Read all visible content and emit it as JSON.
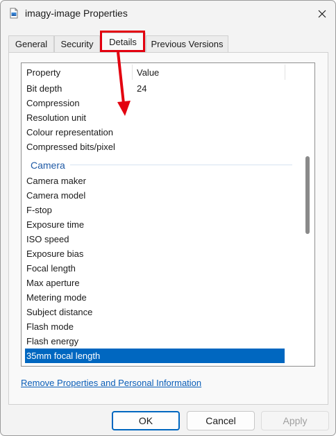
{
  "window": {
    "title": "imagy-image Properties"
  },
  "tabs": [
    "General",
    "Security",
    "Details",
    "Previous Versions"
  ],
  "list": {
    "headers": {
      "property": "Property",
      "value": "Value"
    },
    "image_rows": [
      {
        "property": "Bit depth",
        "value": "24"
      },
      {
        "property": "Compression",
        "value": ""
      },
      {
        "property": "Resolution unit",
        "value": ""
      },
      {
        "property": "Colour representation",
        "value": ""
      },
      {
        "property": "Compressed bits/pixel",
        "value": ""
      }
    ],
    "group_label": "Camera",
    "camera_rows": [
      {
        "property": "Camera maker",
        "value": ""
      },
      {
        "property": "Camera model",
        "value": ""
      },
      {
        "property": "F-stop",
        "value": ""
      },
      {
        "property": "Exposure time",
        "value": ""
      },
      {
        "property": "ISO speed",
        "value": ""
      },
      {
        "property": "Exposure bias",
        "value": ""
      },
      {
        "property": "Focal length",
        "value": ""
      },
      {
        "property": "Max aperture",
        "value": ""
      },
      {
        "property": "Metering mode",
        "value": ""
      },
      {
        "property": "Subject distance",
        "value": ""
      },
      {
        "property": "Flash mode",
        "value": ""
      },
      {
        "property": "Flash energy",
        "value": ""
      },
      {
        "property": "35mm focal length",
        "value": ""
      }
    ]
  },
  "link": "Remove Properties and Personal Information",
  "buttons": {
    "ok": "OK",
    "cancel": "Cancel",
    "apply": "Apply"
  },
  "colors": {
    "accent": "#0067c0",
    "annotation": "#e3000f",
    "link": "#0a5eb8",
    "group": "#1f5aa6"
  }
}
